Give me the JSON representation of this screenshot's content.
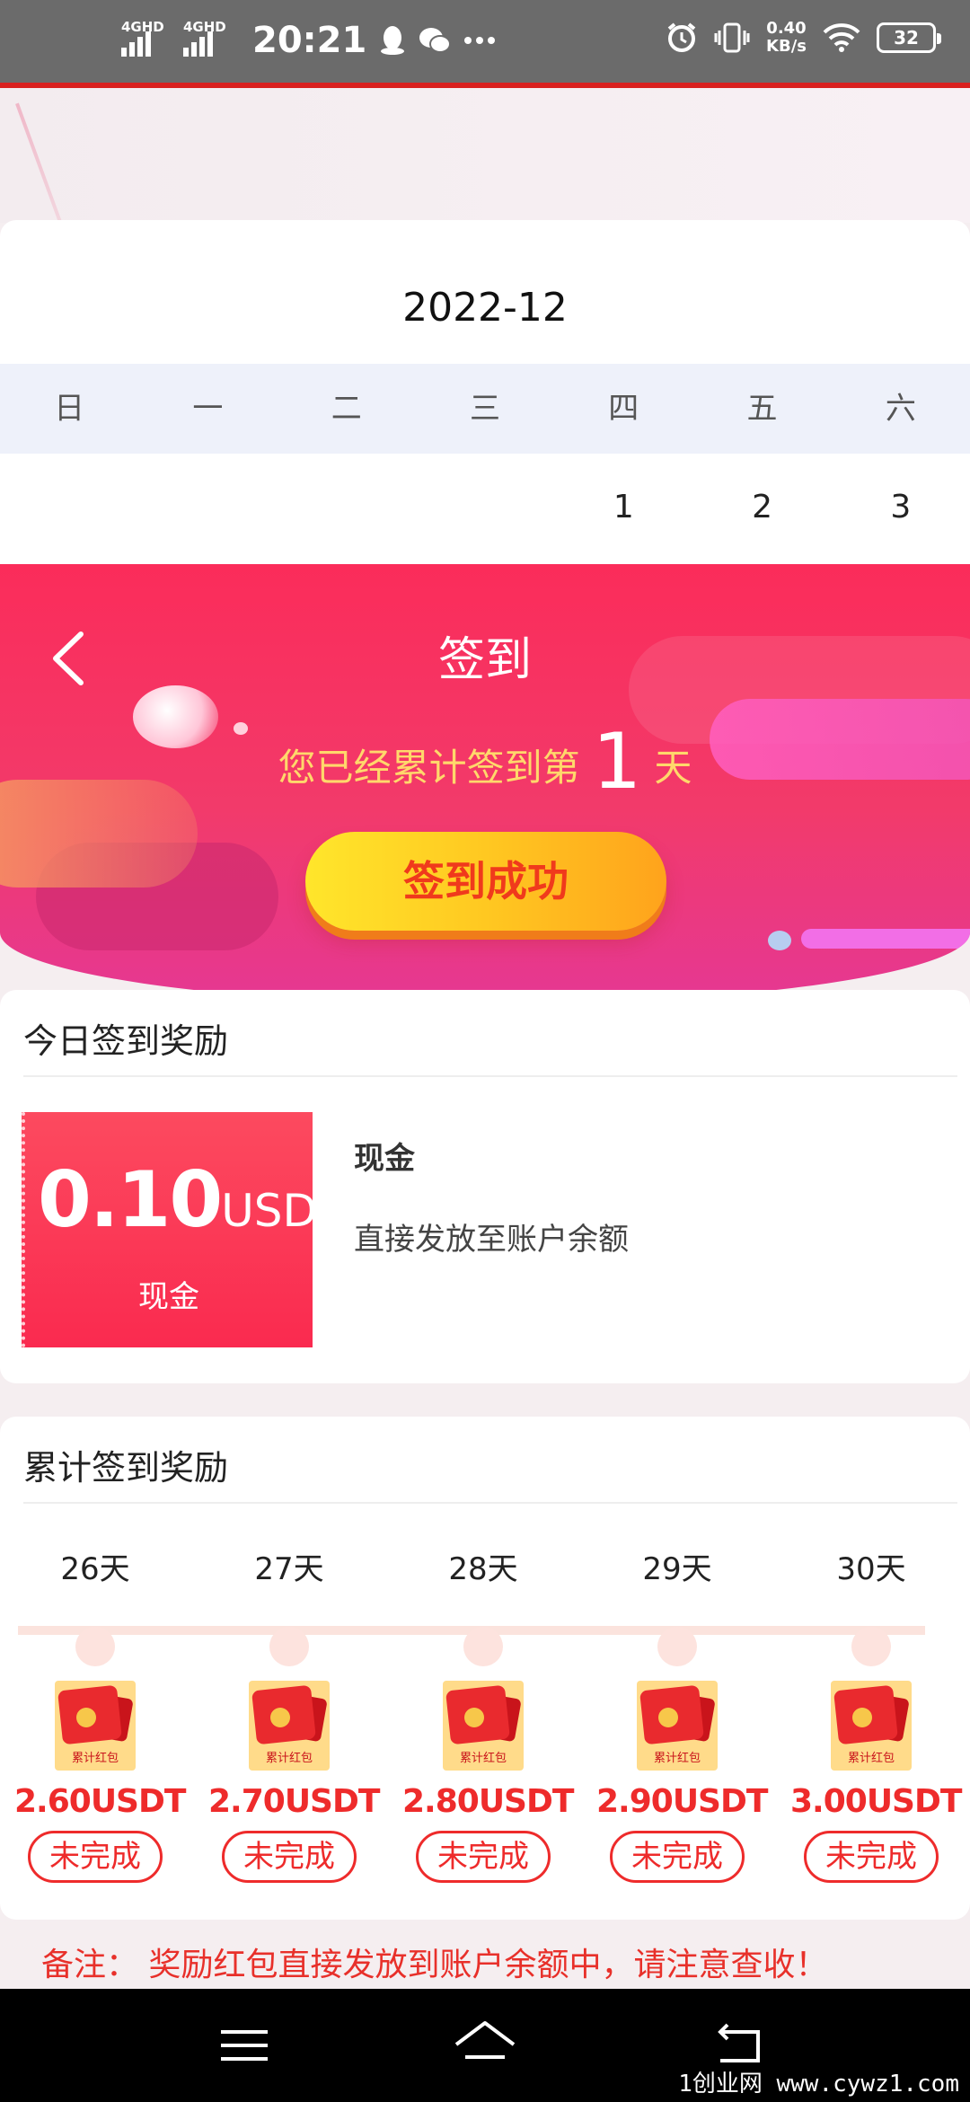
{
  "status_bar": {
    "sim1": "4GHD",
    "sim2": "4GHD",
    "time": "20:21",
    "net_speed_value": "0.40",
    "net_speed_unit": "KB/s",
    "battery": "32"
  },
  "calendar": {
    "month": "2022-12",
    "weekdays": [
      "日",
      "一",
      "二",
      "三",
      "四",
      "五",
      "六"
    ],
    "dates": [
      "",
      "",
      "",
      "",
      "1",
      "2",
      "3"
    ]
  },
  "banner": {
    "title": "签到",
    "total_prefix": "您已经累计签到第",
    "total_days": "1",
    "total_suffix": "天",
    "button_label": "签到成功"
  },
  "today_reward": {
    "section_title": "今日签到奖励",
    "amount": "0.10",
    "unit": "USDT",
    "coupon_type": "现金",
    "name": "现金",
    "description": "直接发放至账户余额"
  },
  "cumulative_reward": {
    "section_title": "累计签到奖励",
    "envelope_label": "累计红包",
    "milestones": [
      {
        "day": "26天",
        "amount": "2.60USDT",
        "status": "未完成"
      },
      {
        "day": "27天",
        "amount": "2.70USDT",
        "status": "未完成"
      },
      {
        "day": "28天",
        "amount": "2.80USDT",
        "status": "未完成"
      },
      {
        "day": "29天",
        "amount": "2.90USDT",
        "status": "未完成"
      },
      {
        "day": "30天",
        "amount": "3.00USDT",
        "status": "未完成"
      }
    ]
  },
  "note": "备注： 奖励红包直接发放到账户余额中，请注意查收！",
  "watermark": "1创业网 www.cywz1.com",
  "colors": {
    "accent_red": "#ee2b2b",
    "banner_pink": "#fb2c5a",
    "button_yellow": "#ffc821",
    "status_bar": "#6b6b6b"
  }
}
